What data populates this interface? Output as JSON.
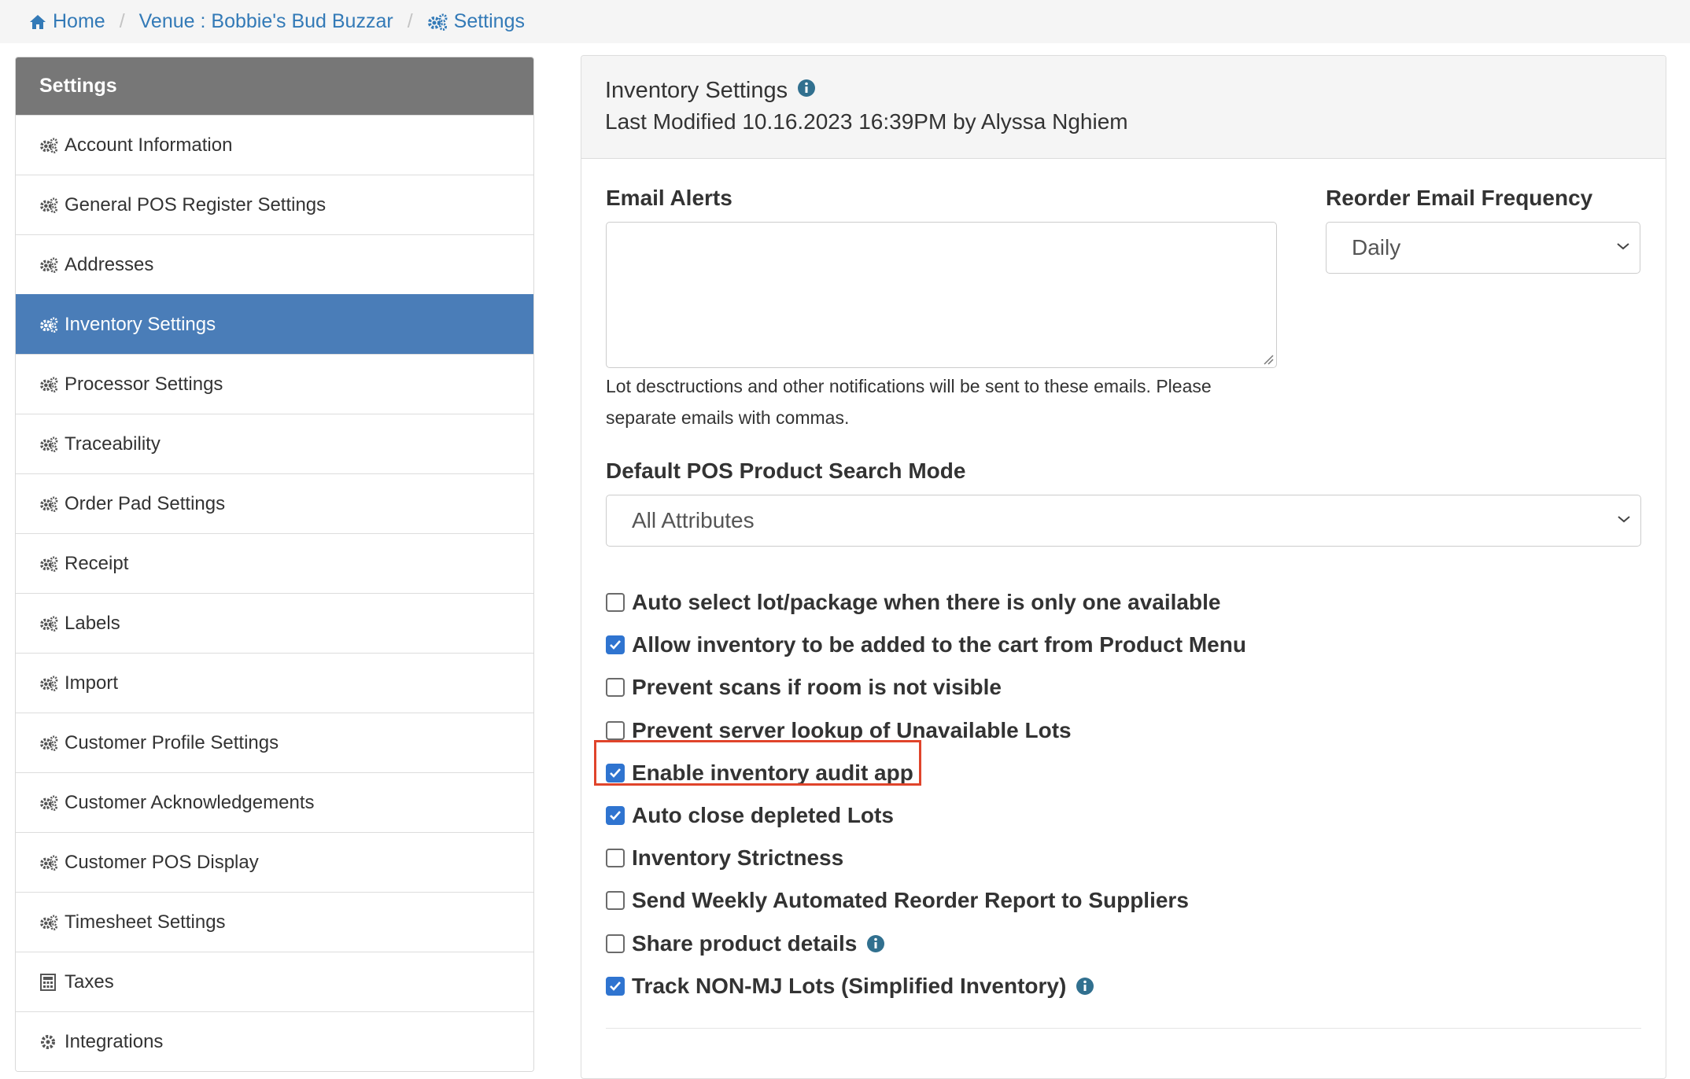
{
  "breadcrumb": {
    "home": "Home",
    "venue": "Venue : Bobbie's Bud Buzzar",
    "settings": "Settings",
    "separator": "/"
  },
  "sidebar": {
    "header": "Settings",
    "active_color": "#4a7db8",
    "items": [
      {
        "label": "Account Information",
        "icon": "gears-icon"
      },
      {
        "label": "General POS Register Settings",
        "icon": "gears-icon"
      },
      {
        "label": "Addresses",
        "icon": "gears-icon"
      },
      {
        "label": "Inventory Settings",
        "icon": "gears-icon",
        "active": true
      },
      {
        "label": "Processor Settings",
        "icon": "gears-icon"
      },
      {
        "label": "Traceability",
        "icon": "gears-icon"
      },
      {
        "label": "Order Pad Settings",
        "icon": "gears-icon"
      },
      {
        "label": "Receipt",
        "icon": "gears-icon"
      },
      {
        "label": "Labels",
        "icon": "gears-icon"
      },
      {
        "label": "Import",
        "icon": "gears-icon"
      },
      {
        "label": "Customer Profile Settings",
        "icon": "gears-icon"
      },
      {
        "label": "Customer Acknowledgements",
        "icon": "gears-icon"
      },
      {
        "label": "Customer POS Display",
        "icon": "gears-icon"
      },
      {
        "label": "Timesheet Settings",
        "icon": "gears-icon"
      },
      {
        "label": "Taxes",
        "icon": "calculator-icon"
      },
      {
        "label": "Integrations",
        "icon": "gear-icon"
      }
    ]
  },
  "panel": {
    "title": "Inventory Settings",
    "last_modified": "Last Modified 10.16.2023 16:39PM by Alyssa Nghiem"
  },
  "form": {
    "email_alerts_label": "Email Alerts",
    "email_alerts_value": "",
    "email_alerts_help": "Lot desctructions and other notifications will be sent to these emails. Please separate emails with commas.",
    "reorder_freq_label": "Reorder Email Frequency",
    "reorder_freq_value": "Daily",
    "search_mode_label": "Default POS Product Search Mode",
    "search_mode_value": "All Attributes"
  },
  "checkboxes": [
    {
      "label": "Auto select lot/package when there is only one available",
      "checked": false
    },
    {
      "label": "Allow inventory to be added to the cart from Product Menu",
      "checked": true
    },
    {
      "label": "Prevent scans if room is not visible",
      "checked": false
    },
    {
      "label": "Prevent server lookup of Unavailable Lots",
      "checked": false
    },
    {
      "label": "Enable inventory audit app",
      "checked": true,
      "highlighted": true
    },
    {
      "label": "Auto close depleted Lots",
      "checked": true
    },
    {
      "label": "Inventory Strictness",
      "checked": false
    },
    {
      "label": "Send Weekly Automated Reorder Report to Suppliers",
      "checked": false
    },
    {
      "label": "Share product details",
      "checked": false,
      "info": true
    },
    {
      "label": "Track NON-MJ Lots (Simplified Inventory)",
      "checked": true,
      "info": true
    }
  ],
  "colors": {
    "link": "#337ab7",
    "checkbox_checked": "#2f74d0",
    "highlight": "#e0442b",
    "info_icon": "#31708f"
  }
}
